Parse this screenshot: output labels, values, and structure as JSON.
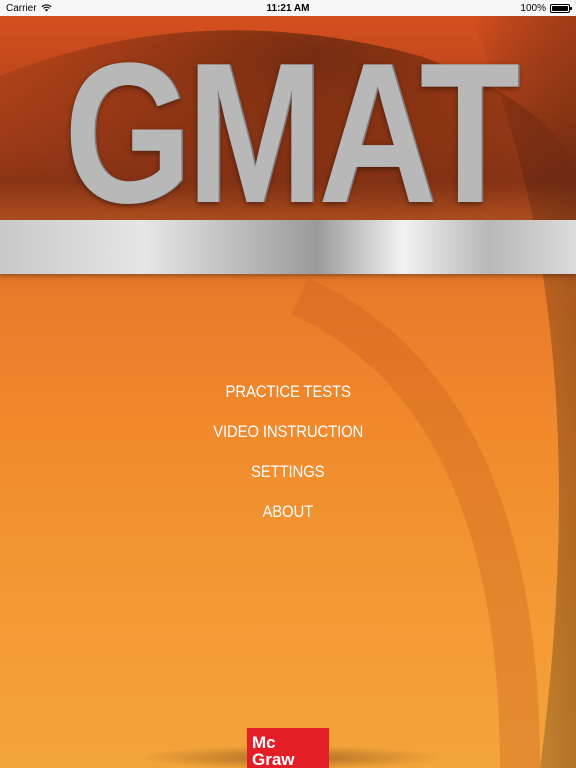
{
  "status_bar": {
    "carrier": "Carrier",
    "time": "11:21 AM",
    "battery": "100%",
    "battery_level": 1.0
  },
  "app": {
    "title": "GMAT"
  },
  "menu": {
    "items": [
      {
        "label": "PRACTICE TESTS"
      },
      {
        "label": "VIDEO INSTRUCTION"
      },
      {
        "label": "SETTINGS"
      },
      {
        "label": "ABOUT"
      }
    ]
  },
  "logo": {
    "line1": "Mc",
    "line2": "Graw"
  },
  "colors": {
    "accent": "#f08a2c",
    "logo_red": "#e41e26"
  }
}
